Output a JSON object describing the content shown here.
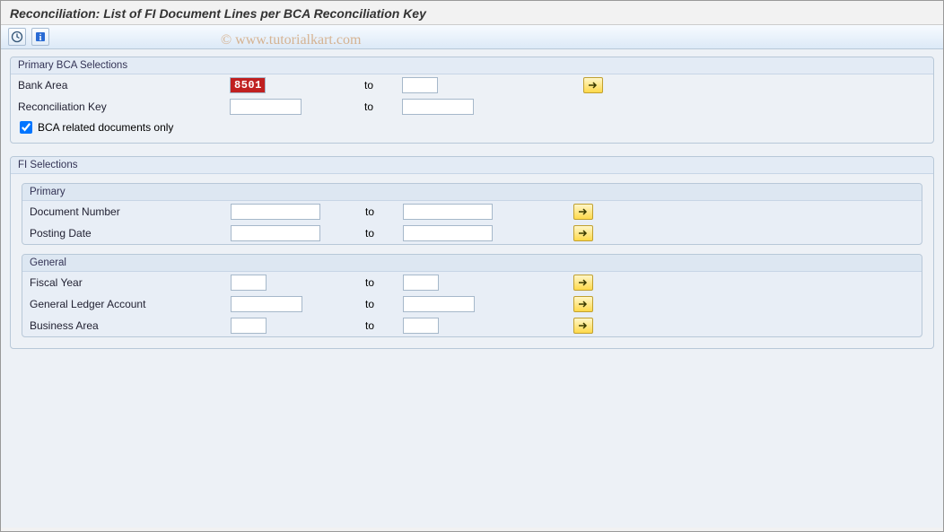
{
  "title": "Reconciliation: List of FI Document Lines per BCA Reconciliation Key",
  "watermark": "© www.tutorialkart.com",
  "labels": {
    "to": "to"
  },
  "group1": {
    "title": "Primary BCA Selections",
    "bank_area_label": "Bank Area",
    "bank_area_from": "8501",
    "bank_area_to": "",
    "recon_key_label": "Reconciliation Key",
    "recon_key_from": "",
    "recon_key_to": "",
    "bca_only_label": "BCA related documents only",
    "bca_only_checked": true
  },
  "group2": {
    "title": "FI Selections",
    "primary": {
      "title": "Primary",
      "docnum_label": "Document Number",
      "docnum_from": "",
      "docnum_to": "",
      "postdate_label": "Posting Date",
      "postdate_from": "",
      "postdate_to": ""
    },
    "general": {
      "title": "General",
      "fy_label": "Fiscal Year",
      "fy_from": "",
      "fy_to": "",
      "gl_label": "General Ledger Account",
      "gl_from": "",
      "gl_to": "",
      "ba_label": "Business Area",
      "ba_from": "",
      "ba_to": ""
    }
  }
}
